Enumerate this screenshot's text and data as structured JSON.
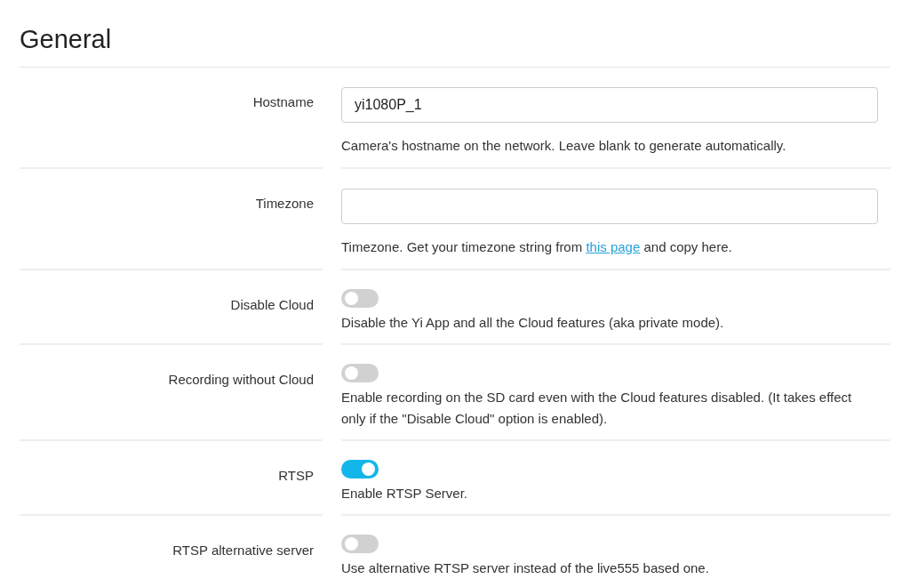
{
  "title": "General",
  "rows": [
    {
      "kind": "text",
      "label": "Hostname",
      "value": "yi1080P_1",
      "help": "Camera's hostname on the network. Leave blank to generate automatically."
    },
    {
      "kind": "text",
      "label": "Timezone",
      "value": "",
      "help": "Timezone. Get your timezone string from",
      "link": "this page",
      "help_after": "and copy here."
    },
    {
      "kind": "toggle",
      "label": "Disable Cloud",
      "on": false,
      "help": "Disable the Yi App and all the Cloud features (aka private mode)."
    },
    {
      "kind": "toggle",
      "label": "Recording without Cloud",
      "on": false,
      "help": "Enable recording on the SD card even with the Cloud features disabled. (It takes effect only if the \"Disable Cloud\" option is enabled)."
    },
    {
      "kind": "toggle",
      "label": "RTSP",
      "on": true,
      "help": "Enable RTSP Server."
    },
    {
      "kind": "toggle",
      "label": "RTSP alternative server",
      "on": false,
      "help": "Use alternative RTSP server instead of the live555 based one."
    }
  ]
}
